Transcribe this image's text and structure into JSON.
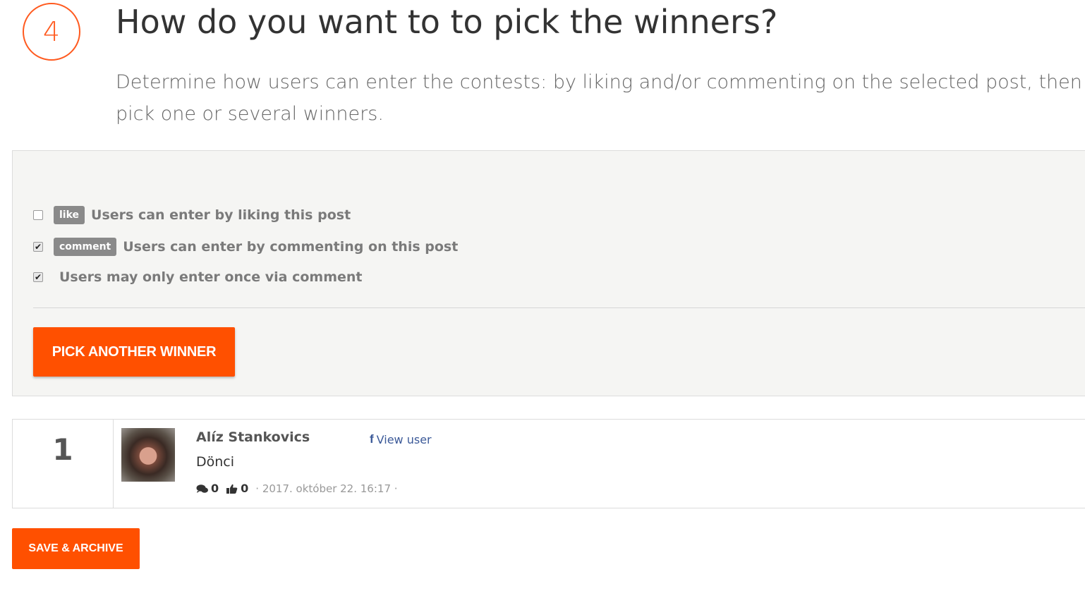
{
  "step": {
    "number": "4"
  },
  "header": {
    "title": "How do you want to to pick the winners?",
    "subtitle": "Determine how users can enter the contests: by liking and/or commenting on the selected post, then pick one or several winners."
  },
  "options": [
    {
      "checked": false,
      "tag": "like",
      "label": "Users can enter by liking this post"
    },
    {
      "checked": true,
      "tag": "comment",
      "label": "Users can enter by commenting on this post"
    },
    {
      "checked": true,
      "tag": "",
      "label": "Users may only enter once via comment"
    }
  ],
  "pick_button": {
    "label": "PICK ANOTHER WINNER"
  },
  "winners": [
    {
      "rank": "1",
      "name": "Alíz Stankovics",
      "view_user_label": "View user",
      "comment": "Dönci",
      "comment_count": "0",
      "like_count": "0",
      "timestamp": "· 2017. október 22. 16:17 ·"
    }
  ],
  "save_button": {
    "label": "SAVE & ARCHIVE"
  },
  "colors": {
    "accent": "#ff5000",
    "facebook": "#3b5998",
    "tag_bg": "#8a8a8a"
  },
  "icons": {
    "fb": "facebook-icon",
    "comments": "comments-icon",
    "likes": "thumbs-up-icon",
    "checkbox_checked": "check-icon"
  }
}
